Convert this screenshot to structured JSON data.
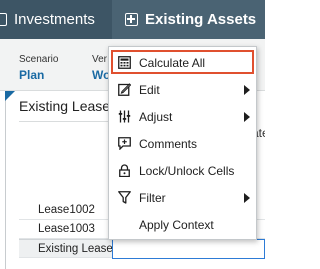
{
  "nav": {
    "investments_label": "Investments",
    "existing_assets_label": "Existing Assets"
  },
  "pov": {
    "scenario_label": "Scenario",
    "scenario_value": "Plan",
    "version_label": "Ver",
    "version_value": "Wo"
  },
  "form": {
    "title": "Existing Lease",
    "column_header_fragment": "ate",
    "rows": [
      {
        "label": "Lease1002"
      },
      {
        "label": "Lease1003"
      },
      {
        "label": "Existing Lease"
      }
    ]
  },
  "context_menu": {
    "items": [
      {
        "label": "Calculate All",
        "icon": "calculator-icon",
        "submenu": false,
        "highlighted": true
      },
      {
        "label": "Edit",
        "icon": "edit-icon",
        "submenu": true
      },
      {
        "label": "Adjust",
        "icon": "adjust-sliders-icon",
        "submenu": true
      },
      {
        "label": "Comments",
        "icon": "comment-icon",
        "submenu": false
      },
      {
        "label": "Lock/Unlock Cells",
        "icon": "lock-icon",
        "submenu": false
      },
      {
        "label": "Filter",
        "icon": "filter-icon",
        "submenu": true
      },
      {
        "label": "Apply Context",
        "icon": "",
        "submenu": false
      }
    ]
  },
  "colors": {
    "topbar": "#3d5565",
    "accent_blue": "#1a6aa3",
    "highlight_border": "#e0502f",
    "selection_border": "#2d7bd6"
  }
}
